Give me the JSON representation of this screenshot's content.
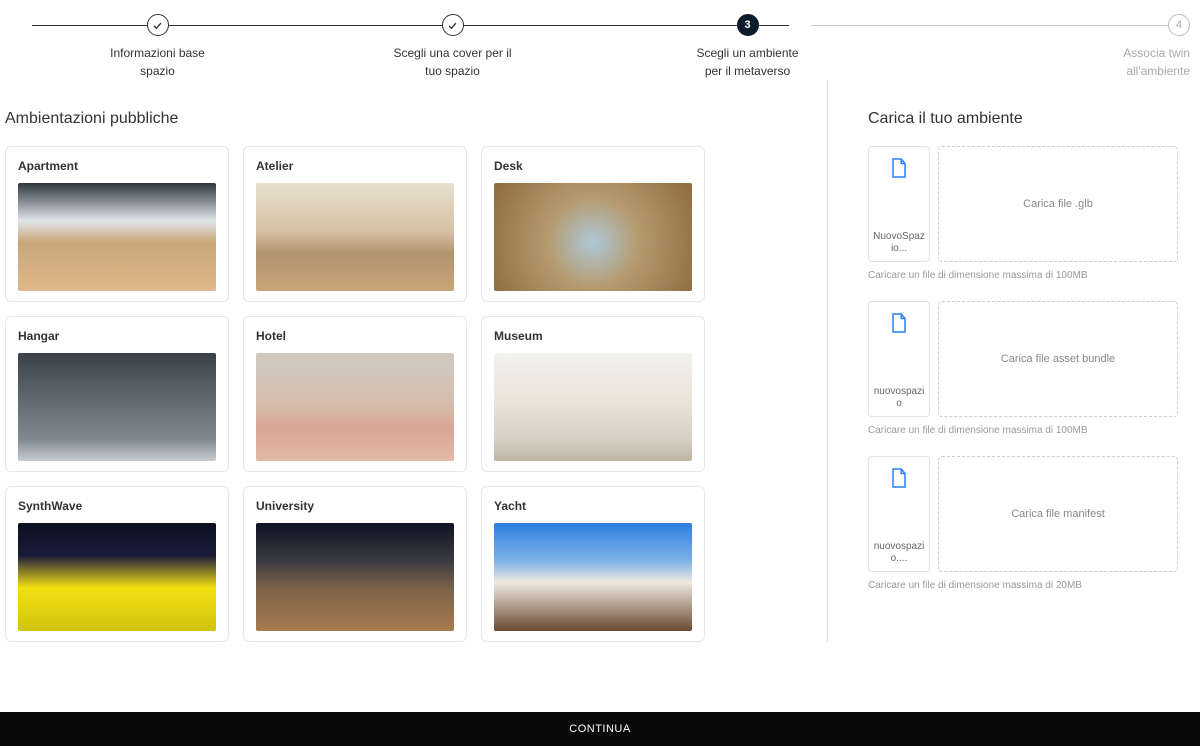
{
  "stepper": {
    "steps": [
      {
        "label": "Informazioni base spazio",
        "state": "done"
      },
      {
        "label": "Scegli una cover per il tuo spazio",
        "state": "done"
      },
      {
        "label": "Scegli un ambiente per il metaverso",
        "state": "active",
        "number": "3"
      },
      {
        "label": "Associa twin all'ambiente",
        "state": "future",
        "number": "4"
      }
    ]
  },
  "left": {
    "title": "Ambientazioni pubbliche",
    "environments": [
      {
        "name": "Apartment"
      },
      {
        "name": "Atelier"
      },
      {
        "name": "Desk"
      },
      {
        "name": "Hangar"
      },
      {
        "name": "Hotel"
      },
      {
        "name": "Museum"
      },
      {
        "name": "SynthWave"
      },
      {
        "name": "University"
      },
      {
        "name": "Yacht"
      }
    ]
  },
  "right": {
    "title": "Carica il tuo ambiente",
    "uploads": [
      {
        "filename": "NuovoSpazio...",
        "drop_label": "Carica file .glb",
        "hint": "Caricare un file di dimensione massima di 100MB"
      },
      {
        "filename": "nuovospazio",
        "drop_label": "Carica file asset bundle",
        "hint": "Caricare un file di dimensione massima di 100MB"
      },
      {
        "filename": "nuovospazio....",
        "drop_label": "Carica file manifest",
        "hint": "Caricare un file di dimensione massima di 20MB"
      }
    ]
  },
  "footer": {
    "continue": "CONTINUA"
  },
  "colors": {
    "accent": "#2a7fff"
  }
}
